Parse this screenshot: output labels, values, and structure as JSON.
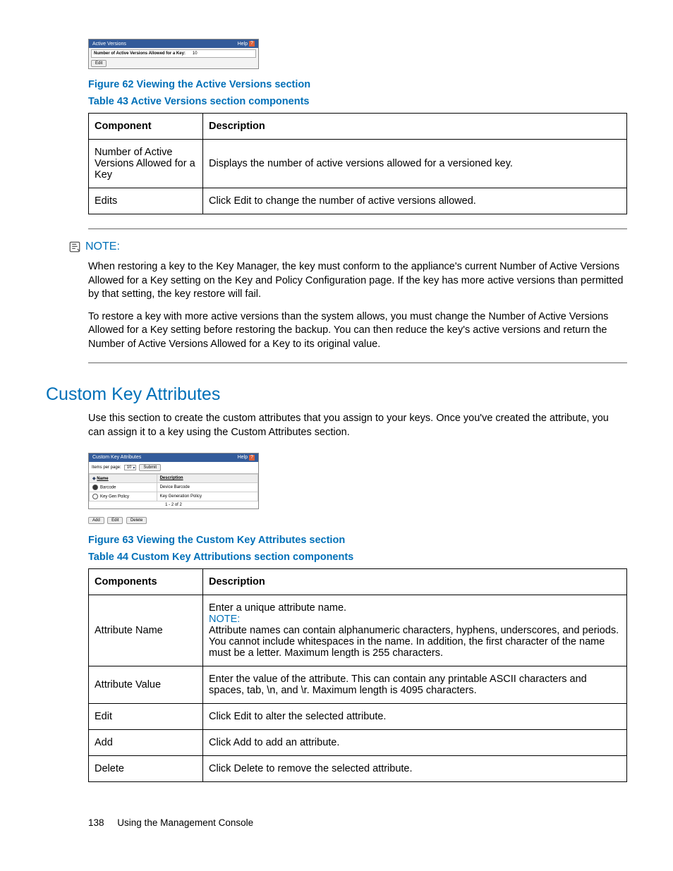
{
  "screenshot1": {
    "title": "Active Versions",
    "help": "Help",
    "row_label": "Number of Active Versions Allowed for a Key:",
    "row_value": "10",
    "edit_btn": "Edit"
  },
  "figure62": "Figure 62 Viewing the Active Versions section",
  "table43_caption": "Table 43 Active Versions section components",
  "table43": {
    "h1": "Component",
    "h2": "Description",
    "rows": [
      {
        "c": "Number of Active Versions Allowed for a Key",
        "d": "Displays the number of active versions allowed for a versioned key."
      },
      {
        "c": "Edits",
        "d": "Click Edit to change the number of active versions allowed."
      }
    ]
  },
  "note": {
    "label": "NOTE:",
    "p1": "When restoring a key to the Key Manager, the key must conform to the appliance's current Number of Active Versions Allowed for a Key setting on the Key and Policy Configuration page. If the key has more active versions than permitted by that setting, the key restore will fail.",
    "p2": "To restore a key with more active versions than the system allows, you must change the Number of Active Versions Allowed for a Key setting before restoring the backup. You can then reduce the key's active versions and return the Number of Active Versions Allowed for a Key to its original value."
  },
  "heading": "Custom Key Attributes",
  "intro": "Use this section to create the custom attributes that you assign to your keys. Once you've created the attribute, you can assign it to a key using the Custom Attributes section.",
  "screenshot2": {
    "title": "Custom Key Attributes",
    "help": "Help",
    "pager_label": "Items per page:",
    "pager_value": "10",
    "submit": "Submit",
    "th_name": "Name",
    "th_desc": "Description",
    "r1_name": "Barcode",
    "r1_desc": "Device Barcode",
    "r2_name": "Key Gen Policy",
    "r2_desc": "Key Generation Policy",
    "page_of": "1 - 2 of 2",
    "add": "Add",
    "edit": "Edit",
    "delete": "Delete"
  },
  "figure63": "Figure 63 Viewing the Custom Key Attributes section",
  "table44_caption": "Table 44 Custom Key Attributions section components",
  "table44": {
    "h1": "Components",
    "h2": "Description",
    "r1_c": "Attribute Name",
    "r1_d1": "Enter a unique attribute name.",
    "r1_note": "NOTE:",
    "r1_d2": "Attribute names can contain alphanumeric characters, hyphens, underscores, and periods. You cannot include whitespaces in the name. In addition, the first character of the name must be a letter. Maximum length is 255 characters.",
    "r2_c": "Attribute Value",
    "r2_d": "Enter the value of the attribute. This can contain any printable ASCII characters and spaces, tab, \\n, and \\r. Maximum length is 4095 characters.",
    "r3_c": "Edit",
    "r3_d": "Click Edit to alter the selected attribute.",
    "r4_c": "Add",
    "r4_d": "Click Add to add an attribute.",
    "r5_c": "Delete",
    "r5_d": "Click Delete to remove the selected attribute."
  },
  "footer": {
    "page": "138",
    "title": "Using the Management Console"
  }
}
